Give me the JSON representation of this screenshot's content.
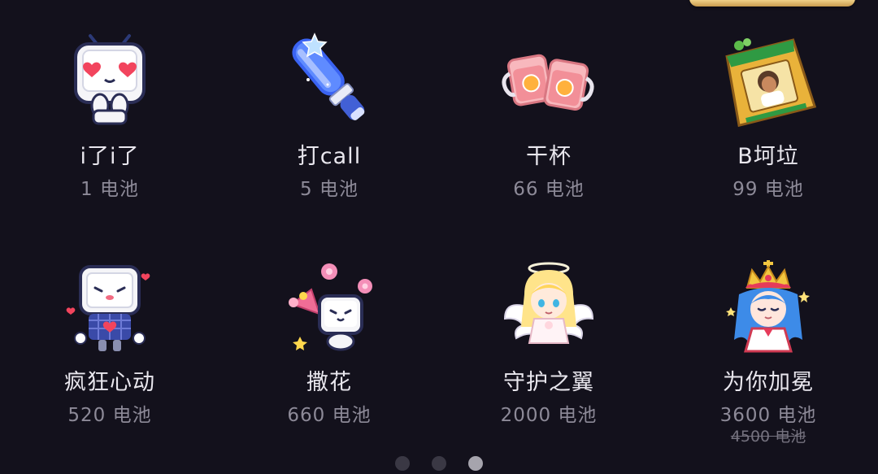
{
  "gifts": [
    {
      "name": "i了i了",
      "price": "1 电池",
      "icon": "tv-heart-eyes-icon"
    },
    {
      "name": "打call",
      "price": "5 电池",
      "icon": "glowstick-icon"
    },
    {
      "name": "干杯",
      "price": "66 电池",
      "icon": "cheers-mugs-icon"
    },
    {
      "name": "B坷垃",
      "price": "99 电池",
      "icon": "fertilizer-bag-icon"
    },
    {
      "name": "疯狂心动",
      "price": "520 电池",
      "icon": "tv-heart-pixel-icon"
    },
    {
      "name": "撒花",
      "price": "660 电池",
      "icon": "tv-flowers-icon"
    },
    {
      "name": "守护之翼",
      "price": "2000 电池",
      "icon": "angel-wings-icon"
    },
    {
      "name": "为你加冕",
      "price": "3600 电池",
      "original_price": "4500 电池",
      "icon": "crown-girl-icon"
    }
  ],
  "pagination": {
    "pages": 3,
    "current": 3
  },
  "colors": {
    "background": "#13111c",
    "name_text": "#e9e7ee",
    "price_text": "#8d8a98",
    "dot_inactive": "#3a3844",
    "dot_active": "#a6a4ad"
  }
}
